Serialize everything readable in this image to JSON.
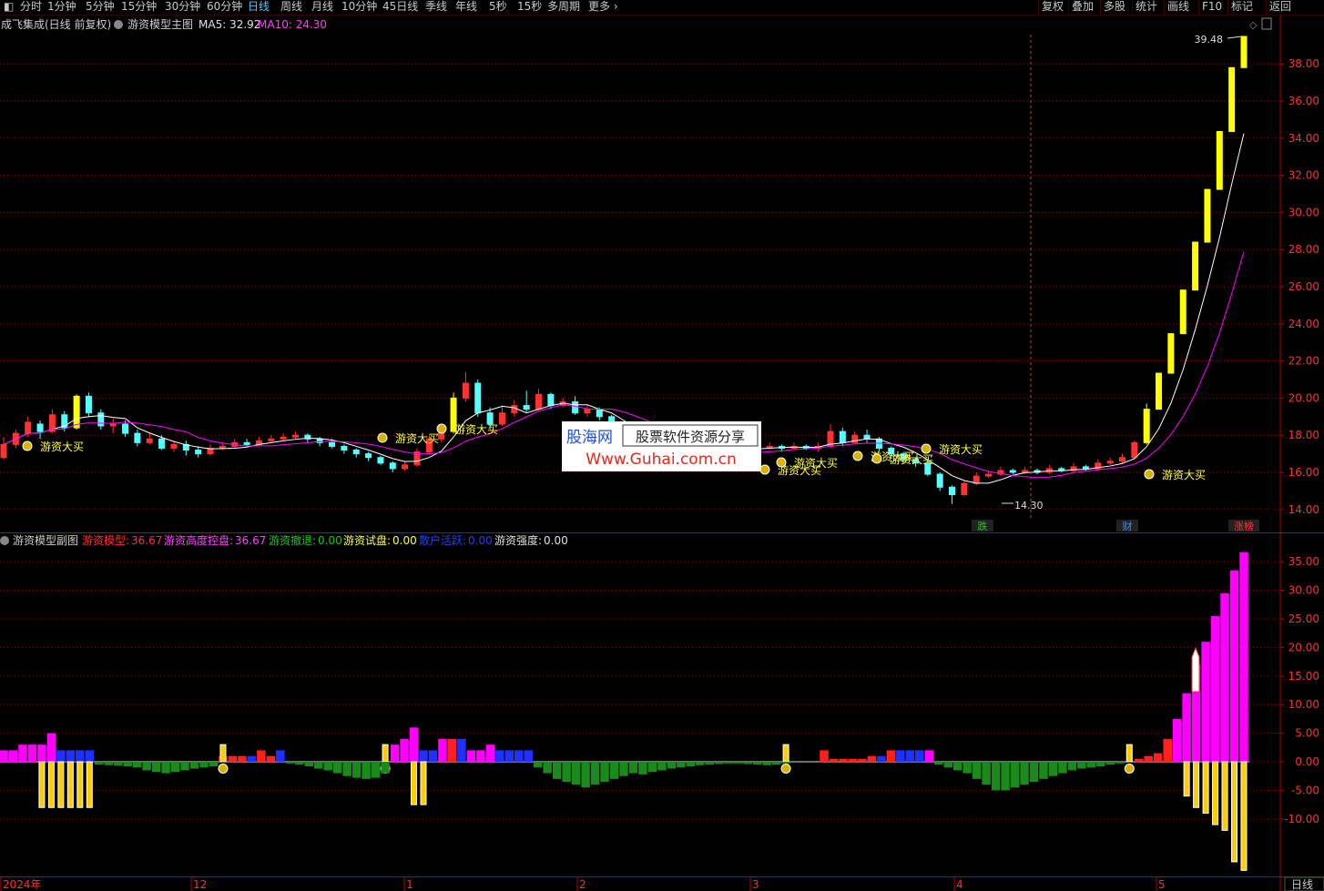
{
  "toolbar": {
    "period_tabs": [
      "分时",
      "1分钟",
      "5分钟",
      "15分钟",
      "30分钟",
      "60分钟",
      "日线",
      "周线",
      "月线",
      "10分钟",
      "45日线",
      "季线",
      "年线",
      "5秒",
      "15秒",
      "多周期",
      "更多"
    ],
    "active_tab": "日线",
    "right_buttons": [
      "复权",
      "叠加",
      "多股",
      "统计",
      "画线",
      "F10",
      "标记",
      "返回"
    ]
  },
  "main_panel": {
    "title": "成飞集成(日线 前复权)",
    "indicator_name": "游资模型主图",
    "ma5_label": "MA5: 32.92",
    "ma10_label": "MA10: 24.30",
    "price_ticks": [
      "38.00",
      "36.00",
      "34.00",
      "32.00",
      "30.00",
      "28.00",
      "26.00",
      "24.00",
      "22.00",
      "20.00",
      "18.00",
      "16.00",
      "14.00"
    ],
    "high_marker": "39.48",
    "low_marker": "14.30",
    "signal_text": "游资大买",
    "event_tags": [
      "跌",
      "财",
      "涨榜"
    ],
    "watermark": {
      "line1": "股海网",
      "line1b": "股票软件资源分享",
      "line2": "Www.Guhai.com.cn"
    }
  },
  "sub_panel": {
    "indicator_name": "游资模型副图",
    "legend": [
      {
        "name": "游资模型",
        "value": "36.67",
        "color": "#ff3030"
      },
      {
        "name": "游资高度控盘",
        "value": "36.67",
        "color": "#ff40ff"
      },
      {
        "name": "游资撤退",
        "value": "0.00",
        "color": "#20c020"
      },
      {
        "name": "游资试盘",
        "value": "0.00",
        "color": "#ffff40"
      },
      {
        "name": "散户活跃",
        "value": "0.00",
        "color": "#2040ff"
      },
      {
        "name": "游资强度",
        "value": "0.00",
        "color": "#e0e0e0"
      }
    ],
    "value_ticks": [
      "35.00",
      "30.00",
      "25.00",
      "20.00",
      "15.00",
      "10.00",
      "5.00",
      "0.00",
      "-5.00",
      "-10.00"
    ]
  },
  "xaxis": {
    "labels": [
      "2024年",
      "12",
      "1",
      "2",
      "3",
      "4",
      "5"
    ],
    "period_label": "日线"
  },
  "colors": {
    "up": "#ff3232",
    "down": "#54ffff",
    "limit_up": "#ffff00",
    "ma5": "#ffffff",
    "ma10": "#ff00ff",
    "grid": "#8b0000",
    "axis": "#b00000"
  },
  "chart_data": {
    "type": "candlestick",
    "candles": [
      [
        16.8,
        17.5,
        17.9,
        16.7
      ],
      [
        17.5,
        18.1,
        18.3,
        17.3
      ],
      [
        18.1,
        18.7,
        19.0,
        17.9
      ],
      [
        18.6,
        18.2,
        18.8,
        17.8
      ],
      [
        18.2,
        19.1,
        19.4,
        18.1
      ],
      [
        19.1,
        18.4,
        19.3,
        18.2
      ],
      [
        18.4,
        20.1,
        20.2,
        18.3
      ],
      [
        20.1,
        19.2,
        20.3,
        19.0
      ],
      [
        19.2,
        18.5,
        19.4,
        18.3
      ],
      [
        18.5,
        18.6,
        18.9,
        18.1
      ],
      [
        18.6,
        18.1,
        18.8,
        17.9
      ],
      [
        18.1,
        17.6,
        18.3,
        17.4
      ],
      [
        17.6,
        17.8,
        18.1,
        17.5
      ],
      [
        17.8,
        17.3,
        18.0,
        17.2
      ],
      [
        17.3,
        17.5,
        17.7,
        17.1
      ],
      [
        17.5,
        17.2,
        17.7,
        16.9
      ],
      [
        17.2,
        17.0,
        17.4,
        16.8
      ],
      [
        17.0,
        17.3,
        17.5,
        16.9
      ],
      [
        17.3,
        17.4,
        17.6,
        17.2
      ],
      [
        17.4,
        17.6,
        17.8,
        17.3
      ],
      [
        17.6,
        17.5,
        17.8,
        17.4
      ],
      [
        17.5,
        17.7,
        17.9,
        17.4
      ],
      [
        17.7,
        17.8,
        18.0,
        17.6
      ],
      [
        17.8,
        17.9,
        18.1,
        17.7
      ],
      [
        17.9,
        18.0,
        18.2,
        17.8
      ],
      [
        18.0,
        17.8,
        18.1,
        17.6
      ],
      [
        17.8,
        17.6,
        17.9,
        17.4
      ],
      [
        17.6,
        17.4,
        17.8,
        17.3
      ],
      [
        17.4,
        17.2,
        17.5,
        17.0
      ],
      [
        17.2,
        17.0,
        17.3,
        16.8
      ],
      [
        17.0,
        16.8,
        17.1,
        16.6
      ],
      [
        16.8,
        16.5,
        16.9,
        16.4
      ],
      [
        16.5,
        16.2,
        16.6,
        16.0
      ],
      [
        16.2,
        16.4,
        16.6,
        16.1
      ],
      [
        16.4,
        17.1,
        17.3,
        16.3
      ],
      [
        17.1,
        17.8,
        18.0,
        17.0
      ],
      [
        17.8,
        18.2,
        18.4,
        17.6
      ],
      [
        18.2,
        20.0,
        20.3,
        18.1
      ],
      [
        20.0,
        20.8,
        21.4,
        19.8
      ],
      [
        20.8,
        19.2,
        21.0,
        19.0
      ],
      [
        19.2,
        18.6,
        19.5,
        18.4
      ],
      [
        18.6,
        19.2,
        19.6,
        18.5
      ],
      [
        19.2,
        19.6,
        19.9,
        19.0
      ],
      [
        19.6,
        19.4,
        20.4,
        19.2
      ],
      [
        19.4,
        20.2,
        20.5,
        19.3
      ],
      [
        20.2,
        19.6,
        20.3,
        19.4
      ],
      [
        19.6,
        19.8,
        20.0,
        19.5
      ],
      [
        19.8,
        19.2,
        20.1,
        19.1
      ],
      [
        19.2,
        19.4,
        19.6,
        19.0
      ],
      [
        19.4,
        19.0,
        19.5,
        18.8
      ],
      [
        19.0,
        18.6,
        19.1,
        18.4
      ],
      [
        18.6,
        17.8,
        18.7,
        17.6
      ],
      [
        17.8,
        17.2,
        17.9,
        17.0
      ],
      [
        17.2,
        17.0,
        17.3,
        16.8
      ],
      [
        17.0,
        16.8,
        17.1,
        16.6
      ],
      [
        16.8,
        16.7,
        16.9,
        16.5
      ],
      [
        16.7,
        16.9,
        17.1,
        16.6
      ],
      [
        16.9,
        17.0,
        17.2,
        16.8
      ],
      [
        17.0,
        17.2,
        17.4,
        16.9
      ],
      [
        17.2,
        17.1,
        17.3,
        17.0
      ],
      [
        17.1,
        17.3,
        17.5,
        17.0
      ],
      [
        17.3,
        17.4,
        17.6,
        17.2
      ],
      [
        17.4,
        17.3,
        17.5,
        17.2
      ],
      [
        17.3,
        17.4,
        17.6,
        17.2
      ],
      [
        17.4,
        17.3,
        17.5,
        17.1
      ],
      [
        17.3,
        17.4,
        17.6,
        17.2
      ],
      [
        17.4,
        17.3,
        17.5,
        17.2
      ],
      [
        17.3,
        17.4,
        17.6,
        17.1
      ],
      [
        17.4,
        18.2,
        18.6,
        17.3
      ],
      [
        18.2,
        17.6,
        18.4,
        17.4
      ],
      [
        17.6,
        18.0,
        18.2,
        17.5
      ],
      [
        18.0,
        17.8,
        18.3,
        17.6
      ],
      [
        17.8,
        17.3,
        17.9,
        17.1
      ],
      [
        17.3,
        17.0,
        17.4,
        16.8
      ],
      [
        17.0,
        16.7,
        17.1,
        16.5
      ],
      [
        16.7,
        16.5,
        16.8,
        16.3
      ],
      [
        16.5,
        15.9,
        16.6,
        15.8
      ],
      [
        15.9,
        15.2,
        16.0,
        15.0
      ],
      [
        15.2,
        14.8,
        15.3,
        14.3
      ],
      [
        14.8,
        15.4,
        15.5,
        14.7
      ],
      [
        15.4,
        15.8,
        16.0,
        15.3
      ],
      [
        15.8,
        15.9,
        16.1,
        15.7
      ],
      [
        15.9,
        16.1,
        16.3,
        15.8
      ],
      [
        16.1,
        16.0,
        16.2,
        15.9
      ],
      [
        16.0,
        16.1,
        16.3,
        15.9
      ],
      [
        16.1,
        16.0,
        16.2,
        15.9
      ],
      [
        16.0,
        16.2,
        16.4,
        15.9
      ],
      [
        16.2,
        16.1,
        16.3,
        16.0
      ],
      [
        16.1,
        16.3,
        16.5,
        16.0
      ],
      [
        16.3,
        16.2,
        16.4,
        16.1
      ],
      [
        16.2,
        16.5,
        16.7,
        16.1
      ],
      [
        16.5,
        16.6,
        16.8,
        16.4
      ],
      [
        16.6,
        16.8,
        17.0,
        16.5
      ],
      [
        16.8,
        17.6,
        17.7,
        16.7
      ],
      [
        17.6,
        19.4,
        19.7,
        17.5
      ],
      [
        19.4,
        21.34,
        21.34,
        19.4
      ],
      [
        21.34,
        23.47,
        23.47,
        21.34
      ],
      [
        23.47,
        25.82,
        25.82,
        23.47
      ],
      [
        25.82,
        28.4,
        28.4,
        25.82
      ],
      [
        28.4,
        31.24,
        31.24,
        28.4
      ],
      [
        31.24,
        34.36,
        34.36,
        31.24
      ],
      [
        34.36,
        37.8,
        37.8,
        34.36
      ],
      [
        37.8,
        39.48,
        39.48,
        37.8
      ]
    ],
    "sub_bars": [
      [
        2,
        0,
        0
      ],
      [
        2,
        0,
        0
      ],
      [
        3,
        0,
        0
      ],
      [
        3,
        0,
        0
      ],
      [
        3,
        -8,
        0
      ],
      [
        5,
        -8,
        0
      ],
      [
        2,
        -8,
        0
      ],
      [
        2,
        -8,
        0
      ],
      [
        2,
        -8,
        0
      ],
      [
        2,
        -8,
        0
      ],
      [
        0,
        0,
        -0.5
      ],
      [
        0,
        0,
        -0.6
      ],
      [
        0,
        0,
        -0.7
      ],
      [
        0,
        0,
        -0.8
      ],
      [
        0,
        0,
        -1
      ],
      [
        0,
        0,
        -1.5
      ],
      [
        0,
        0,
        -1.8
      ],
      [
        0,
        0,
        -2
      ],
      [
        0,
        0,
        -1.8
      ],
      [
        0,
        0,
        -1.5
      ],
      [
        0,
        0,
        -1.2
      ],
      [
        0,
        0,
        -1
      ],
      [
        0,
        0,
        -0.8
      ],
      [
        1,
        3,
        0
      ],
      [
        1,
        0,
        0
      ],
      [
        1,
        0,
        0
      ],
      [
        1,
        0,
        0
      ],
      [
        2,
        0,
        0
      ],
      [
        1,
        0,
        0
      ],
      [
        2,
        0,
        0
      ],
      [
        0,
        0,
        -0.3
      ],
      [
        0,
        0,
        -0.5
      ],
      [
        0,
        0,
        -0.8
      ],
      [
        0,
        0,
        -1.2
      ],
      [
        0,
        0,
        -1.5
      ],
      [
        0,
        0,
        -2
      ],
      [
        0,
        0,
        -2.5
      ],
      [
        0,
        0,
        -2.8
      ],
      [
        0,
        0,
        -3
      ],
      [
        0,
        0,
        -2.8
      ],
      [
        0,
        3,
        -2
      ],
      [
        3,
        0,
        0
      ],
      [
        4,
        0,
        0
      ],
      [
        6,
        -7.5,
        0
      ],
      [
        2,
        -7.5,
        0
      ],
      [
        2,
        0,
        0
      ],
      [
        4,
        0,
        0
      ],
      [
        4,
        0,
        0
      ],
      [
        4,
        0,
        0
      ],
      [
        2,
        0,
        0
      ],
      [
        2,
        0,
        0
      ],
      [
        3,
        0,
        0
      ],
      [
        2,
        0,
        0
      ],
      [
        2,
        0,
        0
      ],
      [
        2,
        0,
        0
      ],
      [
        2,
        0,
        0
      ],
      [
        0,
        0,
        -1
      ],
      [
        0,
        0,
        -2
      ],
      [
        0,
        0,
        -3
      ],
      [
        0,
        0,
        -3.5
      ],
      [
        0,
        0,
        -4
      ],
      [
        0,
        0,
        -4.5
      ],
      [
        0,
        0,
        -4
      ],
      [
        0,
        0,
        -3.5
      ],
      [
        0,
        0,
        -3
      ],
      [
        0,
        0,
        -2.5
      ],
      [
        0,
        0,
        -2
      ],
      [
        0,
        0,
        -2.2
      ],
      [
        0,
        0,
        -1.8
      ],
      [
        0,
        0,
        -1.5
      ],
      [
        0,
        0,
        -1.2
      ],
      [
        0,
        0,
        -1
      ],
      [
        0,
        0,
        -0.8
      ],
      [
        0,
        0,
        -0.6
      ],
      [
        0,
        0,
        -0.5
      ],
      [
        0,
        0,
        -0.4
      ],
      [
        0,
        0,
        -0.3
      ],
      [
        0,
        0,
        -0.3
      ],
      [
        0,
        0,
        -0.4
      ],
      [
        0,
        0,
        -0.5
      ],
      [
        0,
        0,
        -0.6
      ],
      [
        0,
        0,
        -0.5
      ],
      [
        0,
        3,
        -0.3
      ],
      [
        0,
        0,
        0
      ],
      [
        0,
        0,
        0
      ],
      [
        0,
        0,
        0
      ],
      [
        2,
        0,
        0
      ],
      [
        0.5,
        0,
        0
      ],
      [
        0.5,
        0,
        0
      ],
      [
        0.5,
        0,
        0
      ],
      [
        0.5,
        0,
        0
      ],
      [
        1,
        0,
        0
      ],
      [
        1,
        0,
        0
      ],
      [
        2,
        0,
        0
      ],
      [
        2,
        0,
        0
      ],
      [
        2,
        0,
        0
      ],
      [
        2,
        0,
        0
      ],
      [
        2,
        0,
        0
      ],
      [
        0,
        0,
        -0.5
      ],
      [
        0,
        0,
        -1
      ],
      [
        0,
        0,
        -1.5
      ],
      [
        0,
        0,
        -2
      ],
      [
        0,
        0,
        -3
      ],
      [
        0,
        0,
        -4
      ],
      [
        0,
        0,
        -5
      ],
      [
        0,
        0,
        -5
      ],
      [
        0,
        0,
        -4.5
      ],
      [
        0,
        0,
        -4
      ],
      [
        0,
        0,
        -3.5
      ],
      [
        0,
        0,
        -3
      ],
      [
        0,
        0,
        -2.5
      ],
      [
        0,
        0,
        -2
      ],
      [
        0,
        0,
        -1.5
      ],
      [
        0,
        0,
        -1.2
      ],
      [
        0,
        0,
        -1
      ],
      [
        0,
        0,
        -0.8
      ],
      [
        0,
        0,
        -0.5
      ],
      [
        0,
        0,
        -0.3
      ],
      [
        0,
        3,
        0
      ],
      [
        0.5,
        0,
        0
      ],
      [
        1,
        0,
        0
      ],
      [
        1.5,
        0,
        0
      ],
      [
        4,
        0,
        0
      ],
      [
        7.5,
        0,
        0
      ],
      [
        12,
        -6,
        0
      ],
      [
        17,
        -8,
        0
      ],
      [
        21,
        -9,
        0
      ],
      [
        25.5,
        -11,
        0
      ],
      [
        29.5,
        -12,
        0
      ],
      [
        33.5,
        -17.5,
        0
      ],
      [
        36.67,
        -19,
        0
      ]
    ]
  }
}
